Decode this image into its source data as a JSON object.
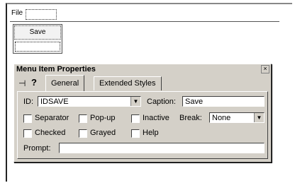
{
  "menubar": {
    "file_label": "File"
  },
  "dropdown": {
    "items": [
      "Save"
    ]
  },
  "dialog": {
    "title": "Menu Item Properties",
    "close_glyph": "×",
    "toolbar": {
      "pin_icon": "⊣",
      "help_icon": "?"
    },
    "tabs": [
      "General",
      "Extended Styles"
    ],
    "id_label": "ID:",
    "id_value": "IDSAVE",
    "caption_label": "Caption:",
    "caption_value": "Save",
    "checkboxes": {
      "separator": {
        "label": "Separator",
        "checked": false
      },
      "popup": {
        "label": "Pop-up",
        "checked": false
      },
      "inactive": {
        "label": "Inactive",
        "checked": false
      },
      "checked": {
        "label": "Checked",
        "checked": false
      },
      "grayed": {
        "label": "Grayed",
        "checked": false
      },
      "help": {
        "label": "Help",
        "checked": false
      }
    },
    "break_label": "Break:",
    "break_value": "None",
    "prompt_label": "Prompt:",
    "prompt_value": ""
  }
}
